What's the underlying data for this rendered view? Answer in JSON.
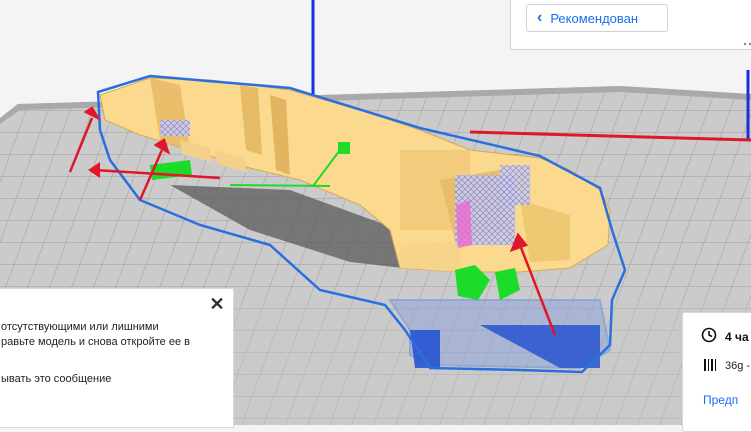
{
  "recommended_panel": {
    "back_label": "Рекомендован"
  },
  "message": {
    "line1": "отсутствующими или лишними",
    "line2": "равьте модель и снова откройте ее в",
    "line3": "ывать это сообщение"
  },
  "print_info": {
    "time": "4 ча",
    "material": "36g -",
    "preview_label": "Предп"
  },
  "colors": {
    "model_yellow": "#fbd98f",
    "outline_blue": "#2a6fe0",
    "axis_red": "#e0162b",
    "axis_green": "#1ddb2a",
    "axis_blue": "#1b2fdc",
    "build_plate": "#c8c8c8",
    "accent": "#196ef0"
  },
  "icons": [
    "chevron-left-icon",
    "close-icon",
    "clock-icon",
    "spool-icon"
  ]
}
